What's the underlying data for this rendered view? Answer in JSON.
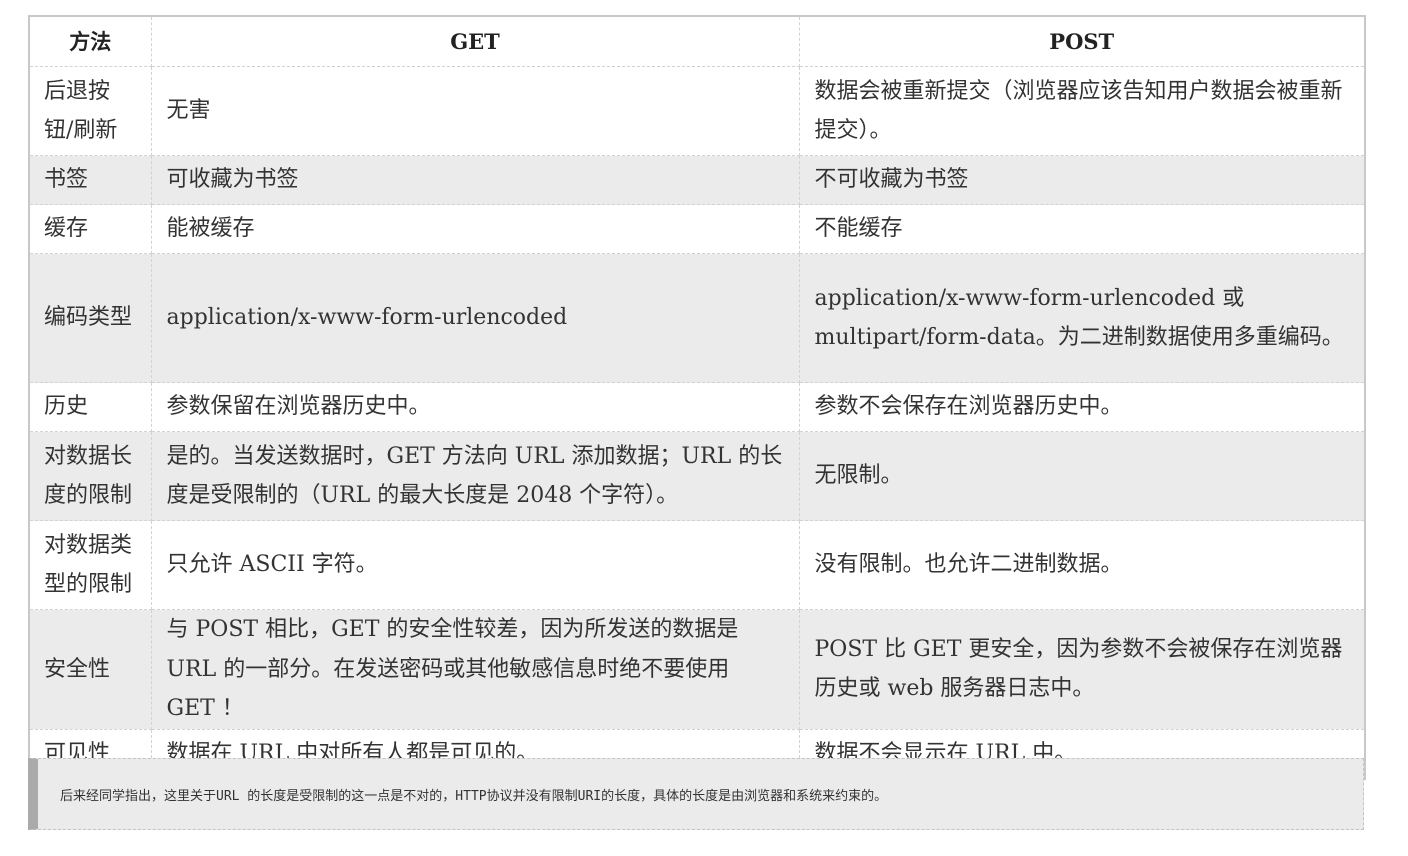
{
  "table": {
    "headers": [
      "方法",
      "GET",
      "POST"
    ],
    "rows": [
      {
        "label": "后退按钮/刷新",
        "get": "无害",
        "post": "数据会被重新提交（浏览器应该告知用户数据会被重新提交）。"
      },
      {
        "label": "书签",
        "get": "可收藏为书签",
        "post": "不可收藏为书签"
      },
      {
        "label": "缓存",
        "get": "能被缓存",
        "post": "不能缓存"
      },
      {
        "label": "编码类型",
        "get": "application/x-www-form-urlencoded",
        "post": "application/x-www-form-urlencoded 或 multipart/form-data。为二进制数据使用多重编码。"
      },
      {
        "label": "历史",
        "get": "参数保留在浏览器历史中。",
        "post": "参数不会保存在浏览器历史中。"
      },
      {
        "label": "对数据长度的限制",
        "get": "是的。当发送数据时，GET 方法向 URL 添加数据；URL 的长度是受限制的（URL 的最大长度是 2048 个字符）。",
        "post": "无限制。"
      },
      {
        "label": "对数据类型的限制",
        "get": "只允许 ASCII 字符。",
        "post": "没有限制。也允许二进制数据。"
      },
      {
        "label": "安全性",
        "get": "与 POST 相比，GET 的安全性较差，因为所发送的数据是 URL 的一部分。在发送密码或其他敏感信息时绝不要使用 GET ！",
        "post": "POST 比 GET 更安全，因为参数不会被保存在浏览器历史或 web 服务器日志中。"
      },
      {
        "label": "可见性",
        "get": "数据在 URL 中对所有人都是可见的。",
        "post": "数据不会显示在 URL 中。"
      }
    ]
  },
  "note": {
    "text": "后来经同学指出，这里关于URL 的长度是受限制的这一点是不对的，HTTP协议并没有限制URI的长度，具体的长度是由浏览器和系统来约束的。"
  }
}
